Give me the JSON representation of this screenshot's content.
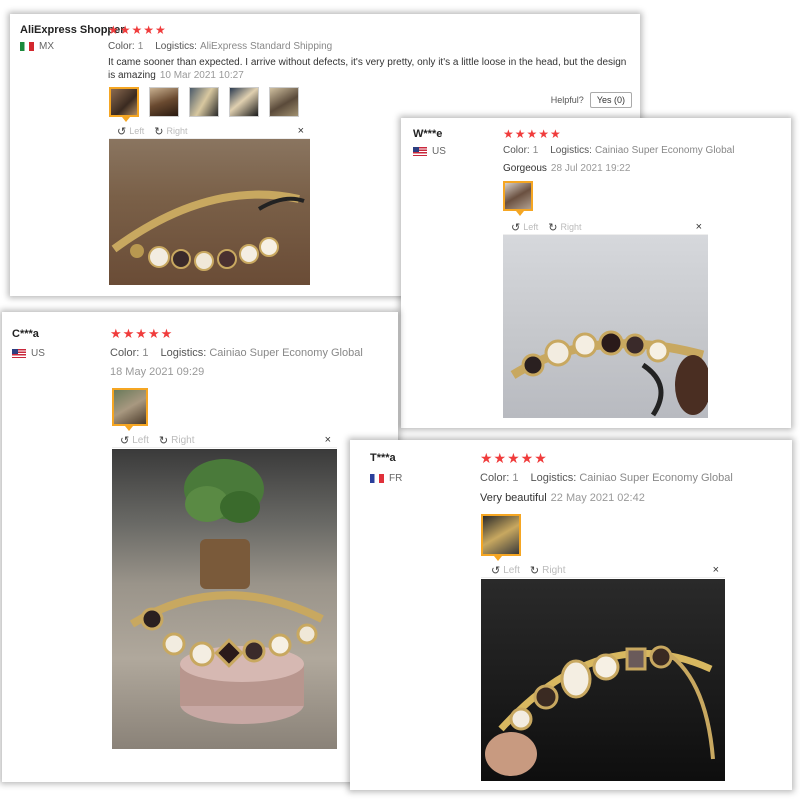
{
  "colors": {
    "star": "#f03c3c",
    "thumb_active": "#f5a623"
  },
  "viewer": {
    "left": "Left",
    "right": "Right",
    "close": "×",
    "rotate_left_icon": "rotate-left-icon",
    "rotate_right_icon": "rotate-right-icon"
  },
  "reviews": [
    {
      "user": "AliExpress Shopper",
      "country": "MX",
      "stars": "★★★★★",
      "color_label": "Color:",
      "color_value": "1",
      "logistics_label": "Logistics:",
      "logistics_value": "AliExpress Standard Shipping",
      "text": "It came sooner than expected. I arrive without defects, it's very pretty, only it's a little loose in the head, but the design is amazing",
      "date": "10 Mar 2021 10:27",
      "helpful_label": "Helpful?",
      "yes_label": "Yes (0)"
    },
    {
      "user": "W***e",
      "country": "US",
      "stars": "★★★★★",
      "color_label": "Color:",
      "color_value": "1",
      "logistics_label": "Logistics:",
      "logistics_value": "Cainiao Super Economy Global",
      "text": "Gorgeous",
      "date": "28 Jul 2021 19:22"
    },
    {
      "user": "C***a",
      "country": "US",
      "stars": "★★★★★",
      "color_label": "Color:",
      "color_value": "1",
      "logistics_label": "Logistics:",
      "logistics_value": "Cainiao Super Economy Global",
      "text": "",
      "date": "18 May 2021 09:29"
    },
    {
      "user": "T***a",
      "country": "FR",
      "stars": "★★★★★",
      "color_label": "Color:",
      "color_value": "1",
      "logistics_label": "Logistics:",
      "logistics_value": "Cainiao Super Economy Global",
      "text": "Very beautiful",
      "date": "22 May 2021 02:42"
    }
  ]
}
